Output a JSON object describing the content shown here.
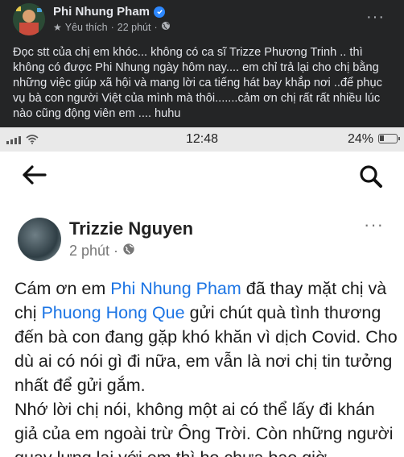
{
  "post": {
    "author": "Phi Nhung Pham",
    "meta_privacy": "Yêu thích",
    "meta_time": "22 phút",
    "more": "···",
    "text": "Đọc stt của chị em khóc... không có ca sĩ Trizze Phương Trinh .. thì không có được Phi Nhung ngày hôm nay.... em chỉ trả lại cho chị bằng những việc giúp xã hội và mang lời ca tiếng hát bay khắp nơi ..để phục vụ bà con người Việt của mình mà thôi.......cảm ơn chị rất rất nhiều lúc nào cũng động viên em .... huhu"
  },
  "screenshot": {
    "status": {
      "time": "12:48",
      "battery_text": "24%",
      "battery_level": 0.24
    },
    "inner_post": {
      "author": "Trizzie Nguyen",
      "time": "2 phút",
      "more": "···",
      "text_1": "Cám ơn em ",
      "mention_1": "Phi Nhung Pham",
      "text_2": " đã thay mặt chị và chị ",
      "mention_2": "Phuong Hong Que",
      "text_3": " gửi chút quà tình thương đến bà con đang gặp khó khăn vì dịch Covid.  Cho dù ai có nói gì đi nữa, em vẫn là nơi chị tin tưởng nhất để gửi gắm.",
      "text_4": "Nhớ lời chị nói, không một ai có thể lấy đi khán giả của em ngoài trừ Ông Trời.  Còn những người quay lưng lại với em thì họ chưa bao giờ"
    }
  }
}
